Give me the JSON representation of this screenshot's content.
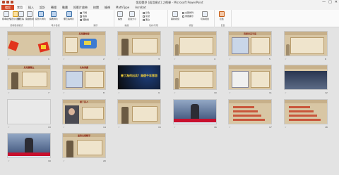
{
  "window": {
    "title": "俄烏戰爭 [兩用模式] 之衝擊 - Microsoft PowerPoint",
    "controls": [
      "—",
      "□",
      "✕"
    ]
  },
  "tabs": [
    {
      "label": "檔案",
      "kind": "file"
    },
    {
      "label": "常用",
      "kind": "active"
    },
    {
      "label": "插入",
      "kind": ""
    },
    {
      "label": "設計",
      "kind": ""
    },
    {
      "label": "轉場",
      "kind": ""
    },
    {
      "label": "動畫",
      "kind": ""
    },
    {
      "label": "投影片放映",
      "kind": ""
    },
    {
      "label": "校閱",
      "kind": ""
    },
    {
      "label": "檢視",
      "kind": ""
    },
    {
      "label": "MathType",
      "kind": ""
    },
    {
      "label": "Acrobat",
      "kind": ""
    }
  ],
  "ribbon": {
    "groups": [
      {
        "label": "簡報檢視模式"
      },
      {
        "label": "母片檢視"
      },
      {
        "label": "顯示"
      },
      {
        "label": "縮放"
      },
      {
        "label": "色彩/灰階"
      },
      {
        "label": "視窗"
      },
      {
        "label": "巨集"
      }
    ],
    "buttons": [
      {
        "label": "標準模式",
        "icon": "normal-view-icon"
      },
      {
        "label": "投影片瀏覽",
        "icon": "slide-sorter-icon"
      },
      {
        "label": "備忘稿",
        "icon": "notes-page-icon"
      },
      {
        "label": "閱讀檢視",
        "icon": "reading-view-icon"
      },
      {
        "label": "投影片母片",
        "icon": "slide-master-icon"
      },
      {
        "label": "講義母片",
        "icon": "handout-master-icon"
      },
      {
        "label": "備忘稿母片",
        "icon": "notes-master-icon"
      },
      {
        "label": "尺規",
        "icon": "ruler-icon"
      },
      {
        "label": "格線",
        "icon": "gridlines-icon"
      },
      {
        "label": "輔助線",
        "icon": "guides-icon"
      },
      {
        "label": "縮放",
        "icon": "zoom-icon"
      },
      {
        "label": "最適大小",
        "icon": "fit-window-icon"
      },
      {
        "label": "彩色",
        "icon": "color-icon"
      },
      {
        "label": "灰階",
        "icon": "grayscale-icon"
      },
      {
        "label": "黑白",
        "icon": "black-white-icon"
      },
      {
        "label": "開新視窗",
        "icon": "new-window-icon"
      },
      {
        "label": "全部排列",
        "icon": "arrange-all-icon"
      },
      {
        "label": "重疊顯示",
        "icon": "cascade-icon"
      },
      {
        "label": "切換視窗",
        "icon": "switch-windows-icon"
      },
      {
        "label": "巨集",
        "icon": "macros-icon"
      }
    ]
  },
  "slides": [
    {
      "num": "1",
      "title": "",
      "theme": "explosion"
    },
    {
      "num": "2",
      "title": "烏克蘭地理",
      "theme": "map"
    },
    {
      "num": "3",
      "title": "",
      "theme": "soldier"
    },
    {
      "num": "4",
      "title": "",
      "theme": "text"
    },
    {
      "num": "5",
      "title": "克里米亞半島",
      "theme": "map2"
    },
    {
      "num": "6",
      "title": "",
      "theme": "text"
    },
    {
      "num": "7",
      "title": "烏克蘭獨立",
      "theme": "soldier"
    },
    {
      "num": "8",
      "title": "北約東擴",
      "theme": "map3"
    },
    {
      "num": "9",
      "title": "普丁為何出兵？烏俄千年恩怨",
      "theme": "dark"
    },
    {
      "num": "10",
      "title": "",
      "theme": "text"
    },
    {
      "num": "11",
      "title": "",
      "theme": "map4"
    },
    {
      "num": "12",
      "title": "",
      "theme": "photo"
    },
    {
      "num": "13",
      "title": "",
      "theme": "blank"
    },
    {
      "num": "14",
      "title": "普丁其人",
      "theme": "portrait"
    },
    {
      "num": "15",
      "title": "",
      "theme": "soldier"
    },
    {
      "num": "16",
      "title": "",
      "theme": "news"
    },
    {
      "num": "17",
      "title": "",
      "theme": "bars"
    },
    {
      "num": "18",
      "title": "",
      "theme": "bars"
    },
    {
      "num": "19",
      "title": "",
      "theme": "news2"
    },
    {
      "num": "20",
      "title": "面對烏俄戰爭",
      "theme": "soldier"
    }
  ],
  "colors": {
    "accent": "#d24726",
    "slide_bg": "#d8c6a4",
    "title_red": "#8a1f11"
  }
}
